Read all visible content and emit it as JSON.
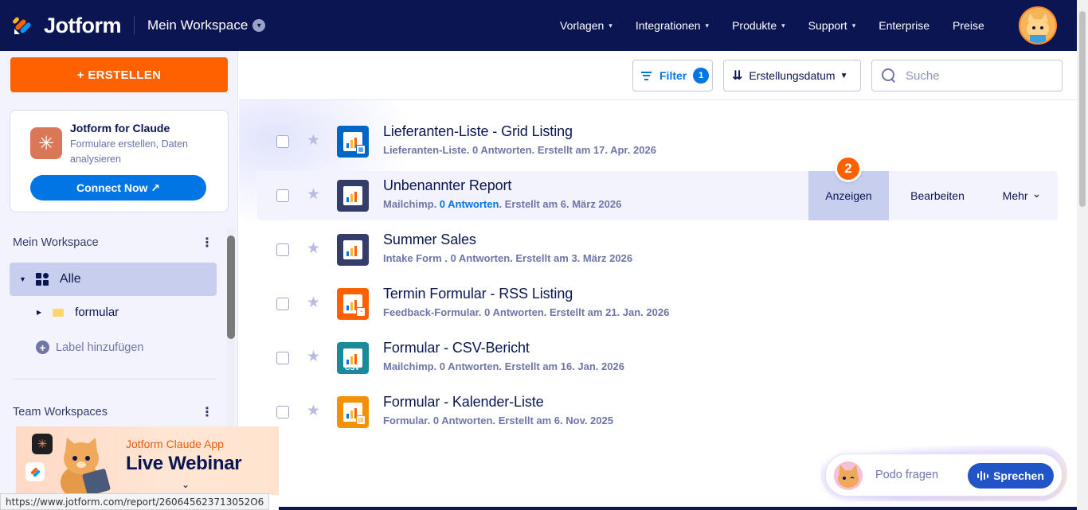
{
  "topnav": {
    "brand": "Jotform",
    "workspace": "Mein Workspace",
    "links": [
      {
        "label": "Vorlagen",
        "chevron": true
      },
      {
        "label": "Integrationen",
        "chevron": true
      },
      {
        "label": "Produkte",
        "chevron": true
      },
      {
        "label": "Support",
        "chevron": true
      },
      {
        "label": "Enterprise",
        "chevron": false
      },
      {
        "label": "Preise",
        "chevron": false
      }
    ]
  },
  "sidebar": {
    "create_label": "+ ERSTELLEN",
    "claude_card": {
      "title": "Jotform for Claude",
      "subtitle": "Formulare erstellen, Daten analysieren",
      "button": "Connect Now ↗"
    },
    "my_workspace": "Mein Workspace",
    "all_label": "Alle",
    "folder_label": "formular",
    "add_label": "Label hinzufügen",
    "team_workspaces": "Team Workspaces"
  },
  "webinar": {
    "kicker": "Jotform Claude App",
    "title": "Live Webinar"
  },
  "status_url": "https://www.jotform.com/report/260645623713052O6",
  "toolbar": {
    "filter_label": "Filter",
    "filter_count": "1",
    "sort_label": "Erstellungsdatum",
    "search_placeholder": "Suche"
  },
  "reports": [
    {
      "title": "Lieferanten-Liste - Grid Listing",
      "meta_pre": "Lieferanten-Liste. 0 Antworten. Erstellt am 17. Apr. 2026",
      "meta_link": "",
      "meta_post": "",
      "color": "#0066c3",
      "icon": "grid"
    },
    {
      "title": "Unbenannter Report",
      "meta_pre": "Mailchimp. ",
      "meta_link": "0 Antworten",
      "meta_post": ". Erstellt am 6. März 2026",
      "color": "#343c6a",
      "icon": "plain"
    },
    {
      "title": "Summer Sales",
      "meta_pre": "Intake Form . 0 Antworten. Erstellt am 3. März 2026",
      "meta_link": "",
      "meta_post": "",
      "color": "#343c6a",
      "icon": "plain"
    },
    {
      "title": "Termin Formular - RSS Listing",
      "meta_pre": "Feedback-Formular. 0 Antworten. Erstellt am 21. Jan. 2026",
      "meta_link": "",
      "meta_post": "",
      "color": "#ff6100",
      "icon": "rss"
    },
    {
      "title": "Formular - CSV-Bericht",
      "meta_pre": "Mailchimp. 0 Antworten. Erstellt am 16. Jan. 2026",
      "meta_link": "",
      "meta_post": "",
      "color": "#1a8a9a",
      "icon": "csv"
    },
    {
      "title": "Formular - Kalender-Liste",
      "meta_pre": "Formular. 0 Antworten. Erstellt am 6. Nov. 2025",
      "meta_link": "",
      "meta_post": "",
      "color": "#f29200",
      "icon": "calendar"
    }
  ],
  "row_actions": {
    "view": "Anzeigen",
    "edit": "Bearbeiten",
    "more": "Mehr"
  },
  "step_badge": "2",
  "csv_text": "CSV",
  "podo": {
    "prompt": "Podo fragen",
    "button": "Sprechen"
  },
  "colors": {
    "nav_bg": "#0a1551",
    "accent_orange": "#ff6100",
    "accent_blue": "#0075e3",
    "sidebar_bg": "#f3f3fe",
    "selected_bg": "#c8ceed"
  }
}
